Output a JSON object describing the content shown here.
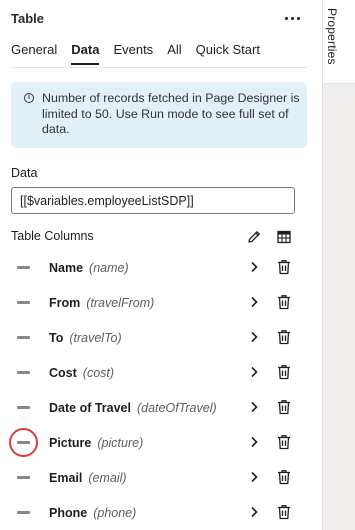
{
  "panel": {
    "title": "Table",
    "more_icon": "more-icon"
  },
  "rail": {
    "tab_label": "Properties"
  },
  "tabs": [
    {
      "label": "General",
      "active": false
    },
    {
      "label": "Data",
      "active": true
    },
    {
      "label": "Events",
      "active": false
    },
    {
      "label": "All",
      "active": false
    },
    {
      "label": "Quick Start",
      "active": false
    }
  ],
  "info": {
    "icon": "info-icon",
    "text": "Number of records fetched in Page Designer is limited to 50. Use Run mode to see full set of data."
  },
  "data_field": {
    "label": "Data",
    "value": "[[$variables.employeeListSDP]]"
  },
  "table_columns": {
    "label": "Table Columns",
    "edit_icon": "pencil-icon",
    "table_icon": "table-icon",
    "rows": [
      {
        "name": "Name",
        "field": "(name)"
      },
      {
        "name": "From",
        "field": "(travelFrom)"
      },
      {
        "name": "To",
        "field": "(travelTo)"
      },
      {
        "name": "Cost",
        "field": "(cost)"
      },
      {
        "name": "Date of Travel",
        "field": "(dateOfTravel)"
      },
      {
        "name": "Picture",
        "field": "(picture)"
      },
      {
        "name": "Email",
        "field": "(email)"
      },
      {
        "name": "Phone",
        "field": "(phone)"
      }
    ]
  },
  "colors": {
    "info_bg": "#e2f1f8",
    "highlight": "#e03b3b",
    "rail_bg": "#f1efed"
  }
}
